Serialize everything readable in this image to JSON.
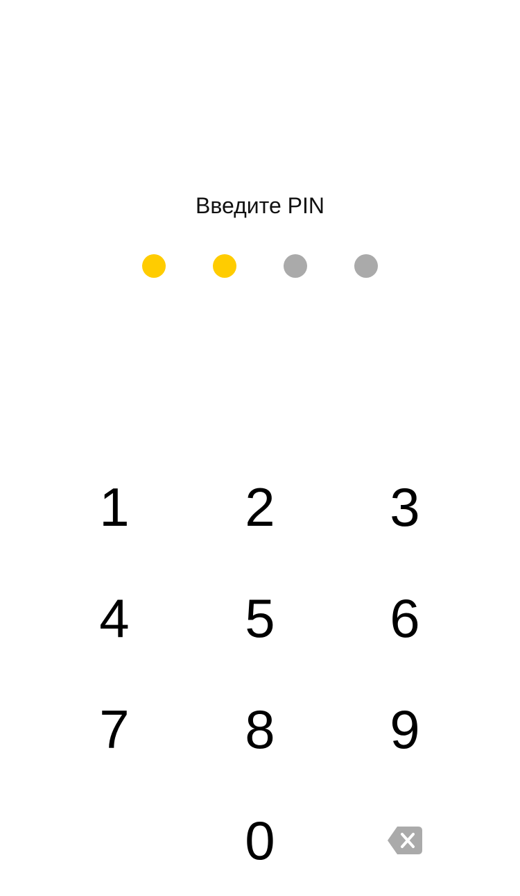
{
  "pin_screen": {
    "prompt": "Введите PIN",
    "pin_length": 4,
    "entered_count": 2,
    "colors": {
      "filled_dot": "#FFCC00",
      "empty_dot": "#AAAAAA",
      "key_text": "#000000",
      "backspace_fill": "#AAAAAA"
    }
  },
  "keypad": {
    "keys": {
      "k1": "1",
      "k2": "2",
      "k3": "3",
      "k4": "4",
      "k5": "5",
      "k6": "6",
      "k7": "7",
      "k8": "8",
      "k9": "9",
      "k0": "0"
    },
    "backspace_icon": "backspace-icon"
  }
}
